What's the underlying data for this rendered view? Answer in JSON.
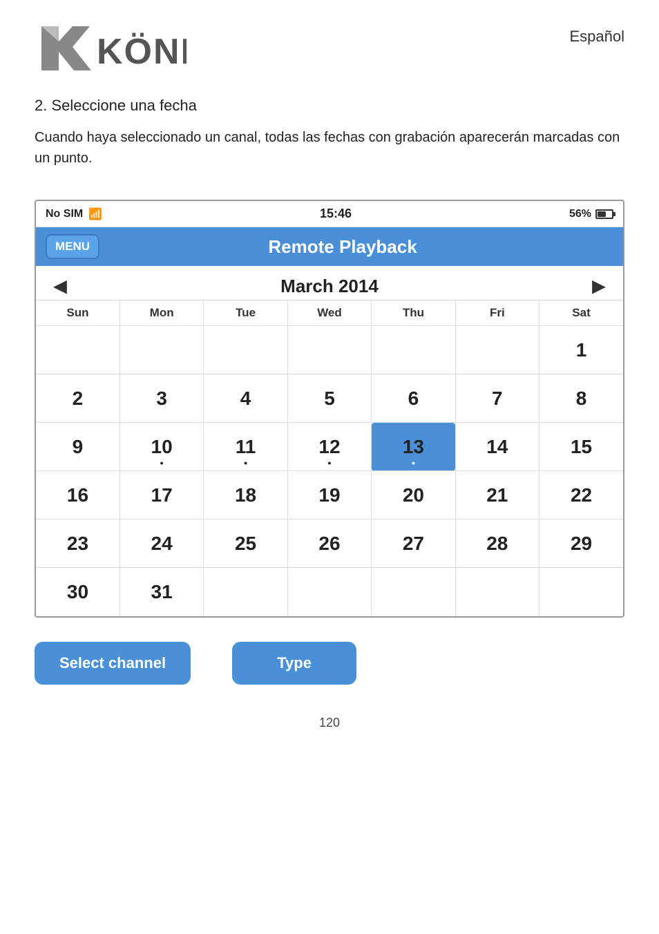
{
  "header": {
    "language": "Español"
  },
  "logo": {
    "alt": "König logo"
  },
  "instructions": {
    "step": "2.   Seleccione una fecha",
    "description": "Cuando haya seleccionado un canal, todas las fechas con grabación aparecerán marcadas con un punto."
  },
  "status_bar": {
    "carrier": "No SIM",
    "time": "15:46",
    "battery_pct": "56%"
  },
  "app_nav": {
    "menu_label": "MENU",
    "title": "Remote Playback"
  },
  "calendar": {
    "prev_label": "◀",
    "next_label": "▶",
    "month_year": "March 2014",
    "days_of_week": [
      "Sun",
      "Mon",
      "Tue",
      "Wed",
      "Thu",
      "Fri",
      "Sat"
    ],
    "weeks": [
      [
        {
          "day": "",
          "empty": true,
          "dot": false,
          "selected": false
        },
        {
          "day": "",
          "empty": true,
          "dot": false,
          "selected": false
        },
        {
          "day": "",
          "empty": true,
          "dot": false,
          "selected": false
        },
        {
          "day": "",
          "empty": true,
          "dot": false,
          "selected": false
        },
        {
          "day": "",
          "empty": true,
          "dot": false,
          "selected": false
        },
        {
          "day": "",
          "empty": true,
          "dot": false,
          "selected": false
        },
        {
          "day": "1",
          "empty": false,
          "dot": false,
          "selected": false
        }
      ],
      [
        {
          "day": "2",
          "empty": false,
          "dot": false,
          "selected": false
        },
        {
          "day": "3",
          "empty": false,
          "dot": false,
          "selected": false
        },
        {
          "day": "4",
          "empty": false,
          "dot": false,
          "selected": false
        },
        {
          "day": "5",
          "empty": false,
          "dot": false,
          "selected": false
        },
        {
          "day": "6",
          "empty": false,
          "dot": false,
          "selected": false
        },
        {
          "day": "7",
          "empty": false,
          "dot": false,
          "selected": false
        },
        {
          "day": "8",
          "empty": false,
          "dot": false,
          "selected": false
        }
      ],
      [
        {
          "day": "9",
          "empty": false,
          "dot": false,
          "selected": false
        },
        {
          "day": "10",
          "empty": false,
          "dot": true,
          "selected": false
        },
        {
          "day": "11",
          "empty": false,
          "dot": true,
          "selected": false
        },
        {
          "day": "12",
          "empty": false,
          "dot": true,
          "selected": false
        },
        {
          "day": "13",
          "empty": false,
          "dot": true,
          "selected": true
        },
        {
          "day": "14",
          "empty": false,
          "dot": false,
          "selected": false
        },
        {
          "day": "15",
          "empty": false,
          "dot": false,
          "selected": false
        }
      ],
      [
        {
          "day": "16",
          "empty": false,
          "dot": false,
          "selected": false
        },
        {
          "day": "17",
          "empty": false,
          "dot": false,
          "selected": false
        },
        {
          "day": "18",
          "empty": false,
          "dot": false,
          "selected": false
        },
        {
          "day": "19",
          "empty": false,
          "dot": false,
          "selected": false
        },
        {
          "day": "20",
          "empty": false,
          "dot": false,
          "selected": false
        },
        {
          "day": "21",
          "empty": false,
          "dot": false,
          "selected": false
        },
        {
          "day": "22",
          "empty": false,
          "dot": false,
          "selected": false
        }
      ],
      [
        {
          "day": "23",
          "empty": false,
          "dot": false,
          "selected": false
        },
        {
          "day": "24",
          "empty": false,
          "dot": false,
          "selected": false
        },
        {
          "day": "25",
          "empty": false,
          "dot": false,
          "selected": false
        },
        {
          "day": "26",
          "empty": false,
          "dot": false,
          "selected": false
        },
        {
          "day": "27",
          "empty": false,
          "dot": false,
          "selected": false
        },
        {
          "day": "28",
          "empty": false,
          "dot": false,
          "selected": false
        },
        {
          "day": "29",
          "empty": false,
          "dot": false,
          "selected": false
        }
      ],
      [
        {
          "day": "30",
          "empty": false,
          "dot": false,
          "selected": false
        },
        {
          "day": "31",
          "empty": false,
          "dot": false,
          "selected": false
        },
        {
          "day": "",
          "empty": true,
          "dot": false,
          "selected": false
        },
        {
          "day": "",
          "empty": true,
          "dot": false,
          "selected": false
        },
        {
          "day": "",
          "empty": true,
          "dot": false,
          "selected": false
        },
        {
          "day": "",
          "empty": true,
          "dot": false,
          "selected": false
        },
        {
          "day": "",
          "empty": true,
          "dot": false,
          "selected": false
        }
      ]
    ]
  },
  "buttons": {
    "select_channel": "Select channel",
    "type": "Type"
  },
  "footer": {
    "page_number": "120"
  }
}
